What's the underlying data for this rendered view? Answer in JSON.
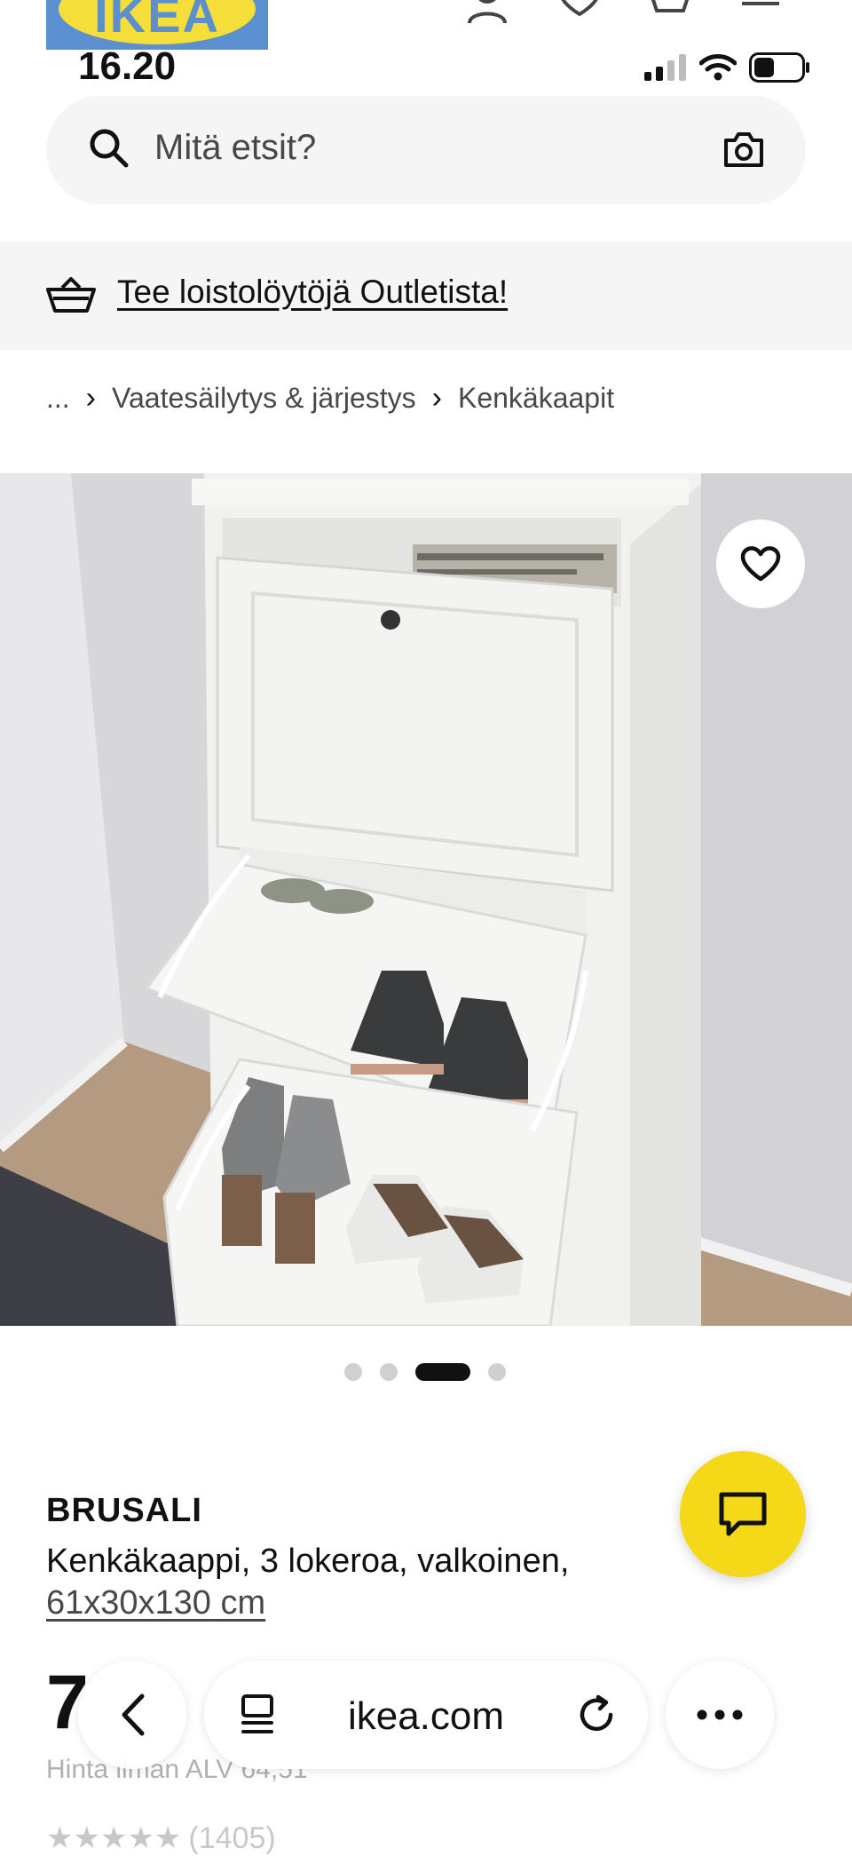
{
  "header": {
    "logo_text": "IKEA",
    "icons": [
      "user-icon",
      "heart-icon",
      "basket-icon",
      "menu-icon"
    ]
  },
  "status_bar": {
    "time": "16.20",
    "icons": [
      "signal-icon",
      "wifi-icon",
      "battery-icon"
    ]
  },
  "search": {
    "placeholder": "Mitä etsit?",
    "icons": [
      "search-icon",
      "camera-icon"
    ]
  },
  "outlet_banner": {
    "text": "Tee loistolöytöjä Outletista!",
    "icon": "basket-icon"
  },
  "breadcrumb": {
    "items": [
      "...",
      "Vaatesäilytys & järjestys",
      "Kenkäkaapit"
    ]
  },
  "carousel": {
    "total": 4,
    "active_index": 3
  },
  "product": {
    "name": "BRUSALI",
    "description": "Kenkäkaappi, 3 lokeroa, valkoinen,",
    "size": "61x30x130 cm",
    "price_visible": "7",
    "price_note": "Hinta ilman ALV 64,51",
    "rating_stars": "★★★★★",
    "rating_count": "(1405)"
  },
  "browser": {
    "url": "ikea.com",
    "icons": [
      "back-icon",
      "tabs-icon",
      "reload-icon",
      "more-icon"
    ]
  },
  "colors": {
    "ikea_yellow": "#f5d817",
    "ikea_blue": "#5b8fd0",
    "light_gray": "#f5f5f5"
  }
}
